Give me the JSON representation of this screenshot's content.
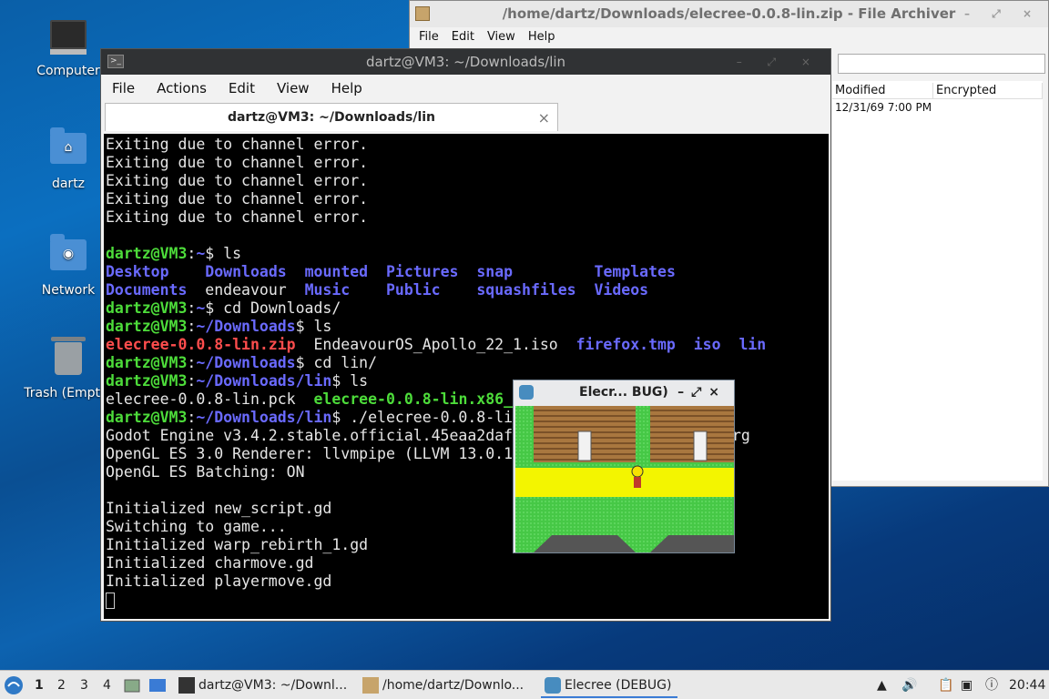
{
  "desktop": {
    "icons": [
      {
        "label": "Computer"
      },
      {
        "label": "dartz"
      },
      {
        "label": "Network"
      },
      {
        "label": "Trash (Empty)"
      }
    ]
  },
  "archiver": {
    "title": "/home/dartz/Downloads/elecree-0.0.8-lin.zip - File Archiver",
    "menu": [
      "File",
      "Edit",
      "View",
      "Help"
    ],
    "columns": [
      "Modified",
      "Encrypted"
    ],
    "row_modified": "12/31/69 7:00 PM"
  },
  "terminal": {
    "title": "dartz@VM3: ~/Downloads/lin",
    "menu": [
      "File",
      "Actions",
      "Edit",
      "View",
      "Help"
    ],
    "tab_label": "dartz@VM3: ~/Downloads/lin",
    "tab_close": "×",
    "lines": {
      "l1": "Exiting due to channel error.",
      "l2": "Exiting due to channel error.",
      "l3": "Exiting due to channel error.",
      "l4": "Exiting due to channel error.",
      "l5": "Exiting due to channel error.",
      "prompt_user": "dartz@VM3",
      "home": "~",
      "cmd_ls": "$ ls",
      "ls_desktop": "Desktop",
      "ls_downloads": "Downloads",
      "ls_mounted": "mounted",
      "ls_pictures": "Pictures",
      "ls_snap": "snap",
      "ls_templates": "Templates",
      "ls_documents": "Documents",
      "ls_endeavour": "endeavour",
      "ls_music": "Music",
      "ls_public": "Public",
      "ls_squashfiles": "squashfiles",
      "ls_videos": "Videos",
      "cmd_cd_downloads": "$ cd Downloads/",
      "path_downloads": "~/Downloads",
      "dl_zip": "elecree-0.0.8-lin.zip",
      "dl_iso": "EndeavourOS_Apollo_22_1.iso",
      "dl_firefox": "firefox.tmp",
      "dl_isodir": "iso",
      "dl_lin": "lin",
      "cmd_cd_lin": "$ cd lin/",
      "path_lin": "~/Downloads/lin",
      "lin_pck": "elecree-0.0.8-lin.pck",
      "lin_x86": "elecree-0.0.8-lin.x86_",
      "cmd_run": "$ ./elecree-0.0.8-li",
      "godot": "Godot Engine v3.4.2.stable.official.45eaa2daf",
      "godot_tail": "rg",
      "opengl": "OpenGL ES 3.0 Renderer: llvmpipe (LLVM 13.0.1",
      "batching": "OpenGL ES Batching: ON",
      "init_new": "Initialized new_script.gd",
      "switching": "Switching to game...",
      "init_warp": "Initialized warp_rebirth_1.gd",
      "init_char": "Initialized charmove.gd",
      "init_player": "Initialized playermove.gd"
    }
  },
  "game": {
    "title": "Elecr... BUG)",
    "buttons": [
      "–",
      "⤢",
      "×"
    ]
  },
  "taskbar": {
    "workspaces": [
      "1",
      "2",
      "3",
      "4"
    ],
    "tasks": [
      {
        "label": "dartz@VM3: ~/Downl..."
      },
      {
        "label": "/home/dartz/Downlo..."
      },
      {
        "label": "Elecree (DEBUG)"
      }
    ],
    "clock": "20:44"
  }
}
